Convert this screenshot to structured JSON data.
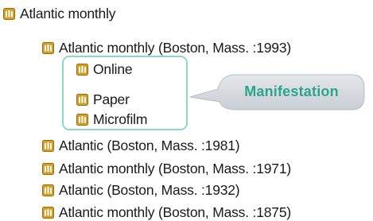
{
  "tree": {
    "root": {
      "label": "Atlantic monthly"
    },
    "children": [
      {
        "label": "Atlantic monthly (Boston, Mass. :1993)"
      },
      {
        "label": "Atlantic (Boston, Mass. :1981)"
      },
      {
        "label": "Atlantic monthly (Boston, Mass. :1971)"
      },
      {
        "label": "Atlantic (Boston, Mass. :1932)"
      },
      {
        "label": "Atlantic monthly (Boston, Mass. :1875)"
      }
    ],
    "manifestations": [
      {
        "label": "Online"
      },
      {
        "label": "Paper"
      },
      {
        "label": "Microfilm"
      }
    ]
  },
  "callout": {
    "label": "Manifestation"
  },
  "colors": {
    "icon_fill": "#d4a126",
    "icon_border": "#9a6d0c",
    "highlight_border": "#8fd6c6",
    "callout_fill": "#d3d7dd",
    "callout_text": "#2aa58b"
  },
  "icon": "book-stack-icon"
}
